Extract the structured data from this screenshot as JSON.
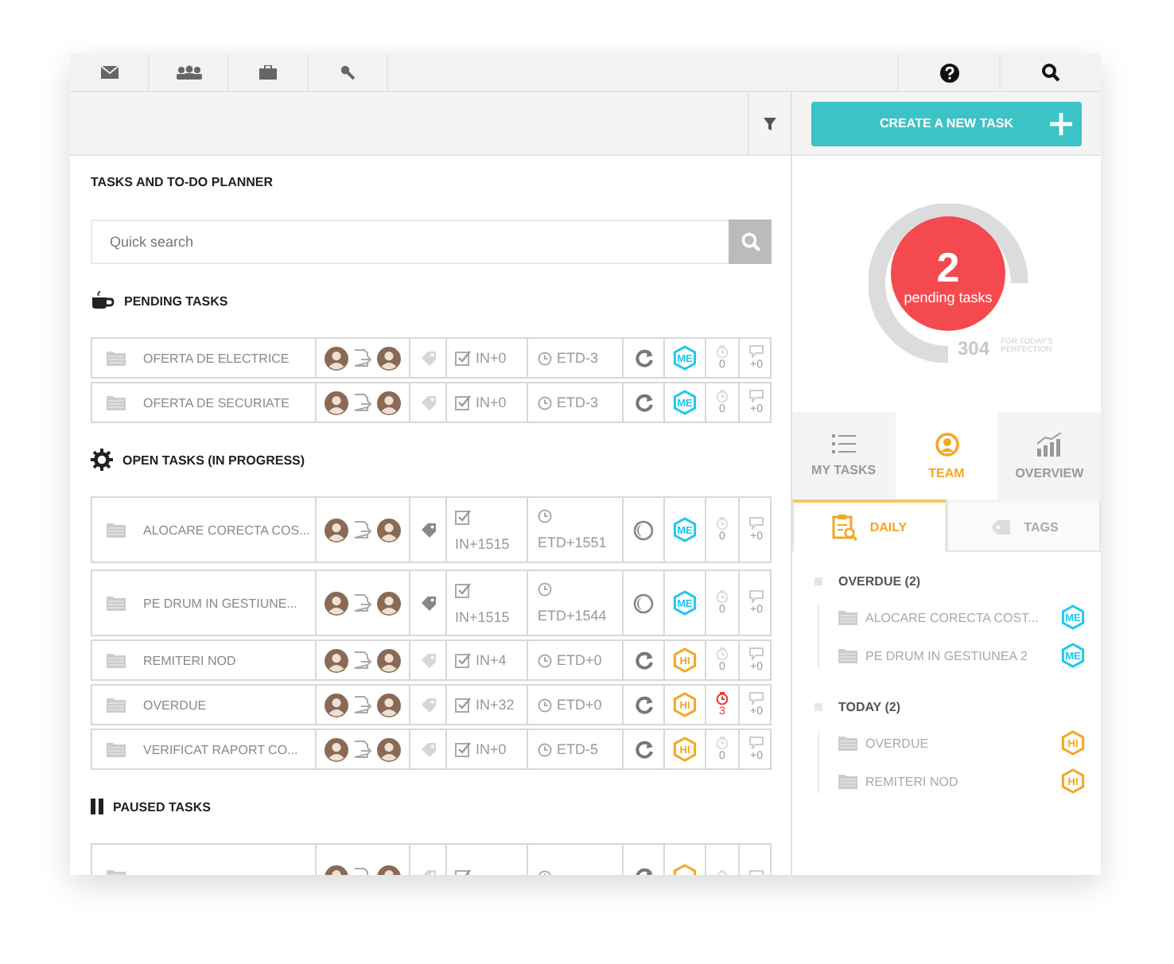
{
  "toolbar": {
    "create_button": "CREATE A NEW TASK"
  },
  "planner": {
    "title": "TASKS AND TO-DO PLANNER",
    "search": {
      "placeholder": "Quick search"
    },
    "sections": [
      {
        "kind": "pending",
        "title": "PENDING TASKS",
        "rows": [
          {
            "kind": "short",
            "name": "OFERTA DE ELECTRICE",
            "tag_active": false,
            "in": "IN+0",
            "etd": "ETD-3",
            "on_hold": false,
            "priority": {
              "label": "ME",
              "color": "#1ec8f0"
            },
            "timer": "0",
            "late": false,
            "comments": "+0"
          },
          {
            "kind": "short",
            "name": "OFERTA DE SECURIATE",
            "tag_active": false,
            "in": "IN+0",
            "etd": "ETD-3",
            "on_hold": false,
            "priority": {
              "label": "ME",
              "color": "#1ec8f0"
            },
            "timer": "0",
            "late": false,
            "comments": "+0"
          }
        ]
      },
      {
        "kind": "open",
        "title": "OPEN TASKS (IN PROGRESS)",
        "rows": [
          {
            "kind": "tall",
            "name": "ALOCARE CORECTA COS...",
            "tag_active": true,
            "in": "IN+1515",
            "etd": "ETD+1551",
            "on_hold": true,
            "priority": {
              "label": "ME",
              "color": "#1ec8f0"
            },
            "timer": "0",
            "late": false,
            "comments": "+0"
          },
          {
            "kind": "tall",
            "name": "PE DRUM IN GESTIUNE...",
            "tag_active": true,
            "in": "IN+1515",
            "etd": "ETD+1544",
            "on_hold": true,
            "priority": {
              "label": "ME",
              "color": "#1ec8f0"
            },
            "timer": "0",
            "late": false,
            "comments": "+0"
          },
          {
            "kind": "short",
            "name": "REMITERI NOD",
            "tag_active": false,
            "in": "IN+4",
            "etd": "ETD+0",
            "on_hold": false,
            "priority": {
              "label": "HI",
              "color": "#f5a623"
            },
            "timer": "0",
            "late": false,
            "comments": "+0"
          },
          {
            "kind": "short",
            "name": "OVERDUE",
            "tag_active": false,
            "in": "IN+32",
            "etd": "ETD+0",
            "on_hold": false,
            "priority": {
              "label": "HI",
              "color": "#f5a623"
            },
            "timer": "3",
            "late": true,
            "comments": "+0"
          },
          {
            "kind": "short",
            "name": "VERIFICAT RAPORT CO...",
            "tag_active": false,
            "in": "IN+0",
            "etd": "ETD-5",
            "on_hold": false,
            "priority": {
              "label": "HI",
              "color": "#f5a623"
            },
            "timer": "0",
            "late": false,
            "comments": "+0"
          }
        ]
      },
      {
        "kind": "paused",
        "title": "PAUSED TASKS",
        "rows": [
          {
            "kind": "tall",
            "tag_active": false,
            "on_hold": false,
            "priority": {
              "color": "#f5a623"
            },
            "late": false
          }
        ]
      }
    ]
  },
  "summary": {
    "count": "2",
    "label": "pending tasks",
    "total": "304",
    "total_note": "FOR TODAY'S PERFECTION"
  },
  "tabs": [
    {
      "label": "MY TASKS",
      "selected": false
    },
    {
      "label": "TEAM",
      "selected": true
    },
    {
      "label": "OVERVIEW",
      "selected": false
    }
  ],
  "subtabs": [
    {
      "label": "DAILY",
      "selected": true
    },
    {
      "label": "TAGS",
      "selected": false
    }
  ],
  "groups": [
    {
      "label": "OVERDUE (2)",
      "children": [
        {
          "name": "ALOCARE CORECTA COST...",
          "priority": {
            "label": "ME",
            "color": "#1ec8f0"
          }
        },
        {
          "name": "PE DRUM IN GESTIUNEA 2",
          "priority": {
            "label": "ME",
            "color": "#1ec8f0"
          }
        }
      ]
    },
    {
      "label": "TODAY (2)",
      "children": [
        {
          "name": "OVERDUE",
          "priority": {
            "label": "HI",
            "color": "#f5a623"
          }
        },
        {
          "name": "REMITERI NOD",
          "priority": {
            "label": "HI",
            "color": "#f5a623"
          }
        }
      ]
    }
  ]
}
